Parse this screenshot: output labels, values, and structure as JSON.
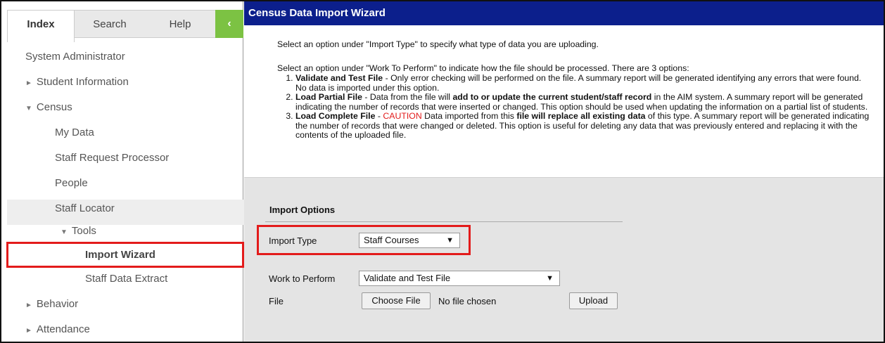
{
  "sidebar": {
    "tabs": {
      "index": "Index",
      "search": "Search",
      "help": "Help",
      "collapse_glyph": "‹"
    },
    "items": [
      {
        "label": "System Administrator",
        "arrow": ""
      },
      {
        "label": "Student Information",
        "arrow": "►"
      },
      {
        "label": "Census",
        "arrow": "▼"
      },
      {
        "label": "My Data",
        "arrow": ""
      },
      {
        "label": "Staff Request Processor",
        "arrow": ""
      },
      {
        "label": "People",
        "arrow": ""
      },
      {
        "label": "Staff Locator",
        "arrow": ""
      },
      {
        "label": "Tools",
        "arrow": "▼"
      },
      {
        "label": "Import Wizard",
        "arrow": ""
      },
      {
        "label": "Staff Data Extract",
        "arrow": ""
      },
      {
        "label": "Behavior",
        "arrow": "►"
      },
      {
        "label": "Attendance",
        "arrow": "►"
      }
    ]
  },
  "main": {
    "title": "Census Data Import Wizard",
    "intro1": "Select an option under \"Import Type\" to specify what type of data you are uploading.",
    "intro2": "Select an option under \"Work To Perform\" to indicate how the file should be processed. There are 3 options:",
    "opt1": {
      "bold": "Validate and Test File",
      "text": " - Only error checking will be performed on the file. A summary report will be generated identifying any errors that were found. No data is imported under this option."
    },
    "opt2": {
      "bold": "Load Partial File",
      "text_a": " - Data from the file will ",
      "bold2": "add to or update the current student/staff record",
      "text_b": " in the AIM system. A summary report will be generated indicating the number of records that were inserted or changed. This option should be used when updating the information on a partial list of students."
    },
    "opt3": {
      "bold": "Load Complete File",
      "dash": " - ",
      "caution": "CAUTION",
      "text_a": " Data imported from this ",
      "bold2": "file will replace all existing data",
      "text_b": " of this type. A summary report will be generated indicating the number of records that were changed or deleted. This option is useful for deleting any data that was previously entered and replacing it with the contents of the uploaded file."
    },
    "import_options_header": "Import Options",
    "import_type_label": "Import Type",
    "import_type_value": "Staff Courses",
    "work_label": "Work to Perform",
    "work_value": "Validate and Test File",
    "file_label": "File",
    "choose_file": "Choose File",
    "no_file": "No file chosen",
    "upload": "Upload",
    "caret": "▼"
  }
}
